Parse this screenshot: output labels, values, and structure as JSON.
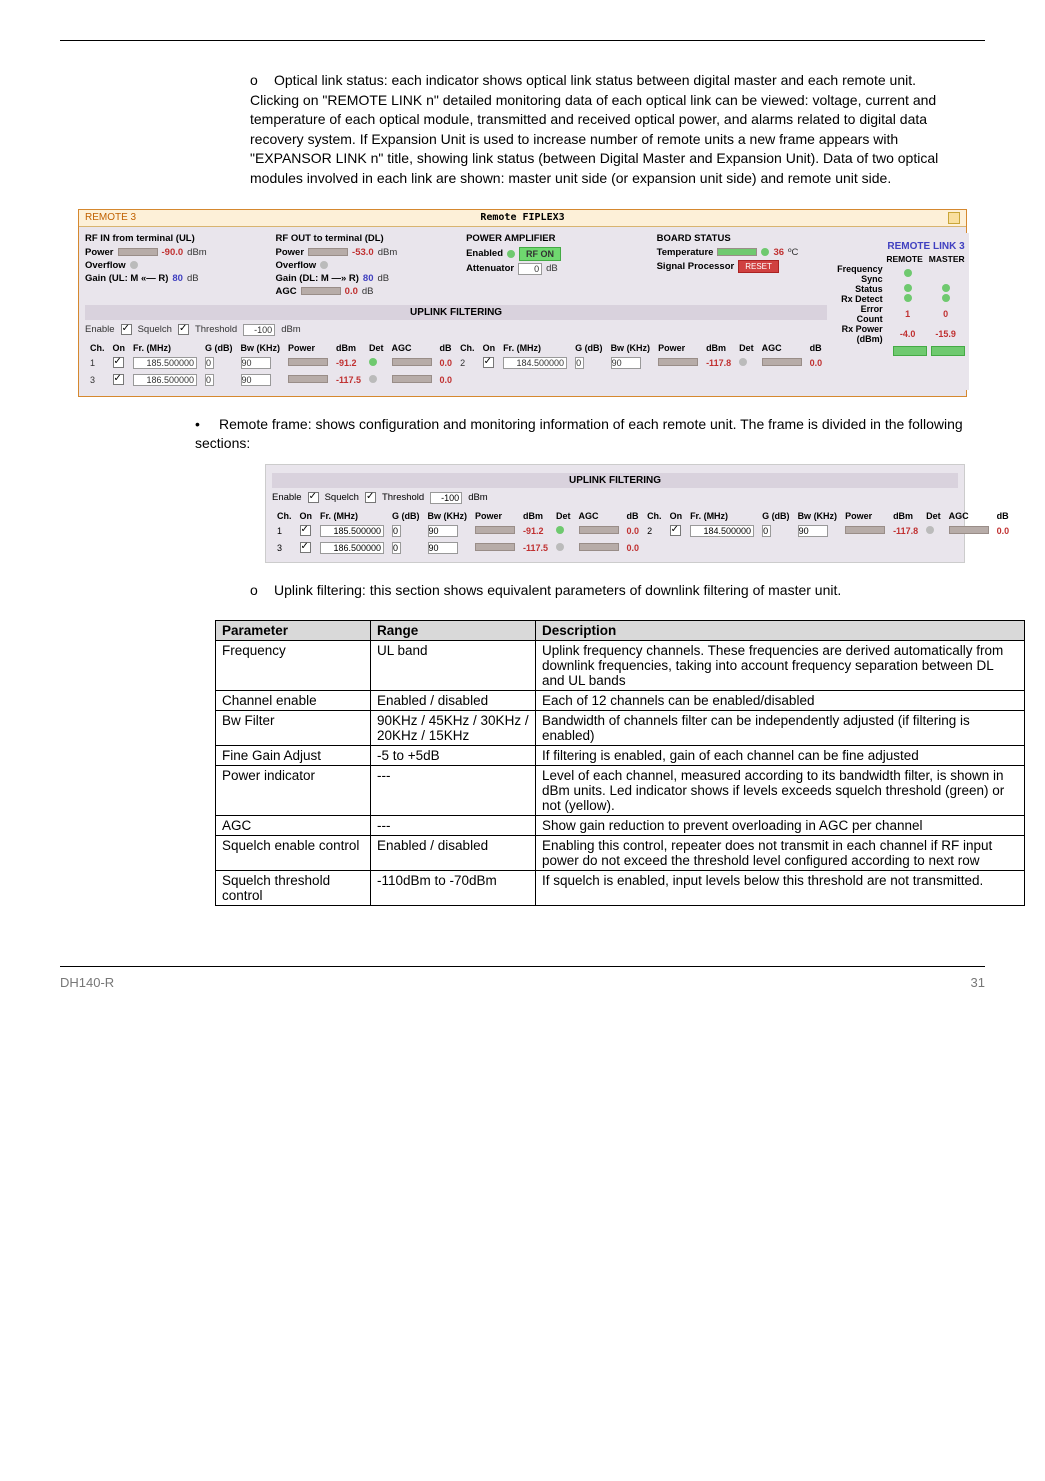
{
  "para1": "Optical link status: each indicator shows optical link status between digital master and each remote unit. Clicking on \"REMOTE LINK n\" detailed monitoring data of each optical link can be viewed: voltage, current and temperature of each optical module, transmitted and received optical power, and alarms related to digital data recovery system. If Expansion Unit is used to increase number of remote units a new frame appears with \"EXPANSOR LINK n\" title, showing link status (between Digital Master and Expansion Unit). Data of two optical modules involved in each link are shown: master unit side (or expansion unit side) and remote unit side.",
  "para2": "Remote frame: shows configuration and monitoring information of each remote unit. The frame is divided in the following sections:",
  "para3": "Uplink filtering: this section shows equivalent parameters of downlink filtering of master unit.",
  "panel": {
    "left_label": "REMOTE 3",
    "center_label": "Remote FIPLEX3",
    "rfin_title": "RF IN from terminal (UL)",
    "rfout_title": "RF OUT to terminal (DL)",
    "pa_title": "POWER AMPLIFIER",
    "board_title": "BOARD STATUS",
    "power": "Power",
    "overflow": "Overflow",
    "gain_ul": "Gain (UL: M «— R)",
    "gain_dl": "Gain (DL: M —» R)",
    "agc": "AGC",
    "enabled": "Enabled",
    "attenuator": "Attenuator",
    "temperature": "Temperature",
    "sigproc": "Signal Processor",
    "rf_on": "RF ON",
    "reset": "RESET",
    "val_rfin_power": "-90.0",
    "val_rfout_power": "-53.0",
    "val_gain_ul": "80",
    "val_gain_dl": "80",
    "val_agc": "0.0",
    "val_att": "0",
    "val_temp": "36",
    "unit_dbm": "dBm",
    "unit_db": "dB",
    "unit_c": "ºC",
    "uplink_banner": "UPLINK FILTERING",
    "enable_lbl": "Enable",
    "squelch_lbl": "Squelch",
    "threshold_lbl": "Threshold",
    "threshold_val": "-100",
    "hdr": {
      "ch": "Ch.",
      "on": "On",
      "fr": "Fr. (MHz)",
      "g": "G (dB)",
      "bw": "Bw (KHz)",
      "pwr": "Power",
      "dbm": "dBm",
      "det": "Det",
      "agc": "AGC",
      "db": "dB"
    },
    "rows": [
      {
        "ch": "1",
        "fr": "185.500000",
        "g": "0",
        "bw": "90",
        "pwr": "-91.2",
        "agc": "0.0"
      },
      {
        "ch": "2",
        "fr": "184.500000",
        "g": "0",
        "bw": "90",
        "pwr": "-117.8",
        "agc": "0.0"
      },
      {
        "ch": "3",
        "fr": "186.500000",
        "g": "0",
        "bw": "90",
        "pwr": "-117.5",
        "agc": "0.0"
      }
    ],
    "link_title": "REMOTE LINK 3",
    "link_hdr_remote": "REMOTE",
    "link_hdr_master": "MASTER",
    "link_rows": {
      "fs": "Frequency Sync",
      "status": "Status",
      "rxdet": "Rx Detect",
      "err": "Error Count",
      "rxpwr": "Rx Power (dBm)"
    },
    "link_vals": {
      "err_r": "1",
      "err_m": "0",
      "rx_r": "-4.0",
      "rx_m": "-15.9"
    }
  },
  "table": {
    "h1": "Parameter",
    "h2": "Range",
    "h3": "Description",
    "rows": [
      {
        "p": "Frequency",
        "r": "UL band",
        "d": "Uplink frequency channels. These frequencies are derived automatically from downlink frequencies, taking into account frequency separation between DL and UL bands"
      },
      {
        "p": "Channel enable",
        "r": "Enabled / disabled",
        "d": "Each of 12 channels can be enabled/disabled"
      },
      {
        "p": "Bw Filter",
        "r": "90KHz / 45KHz / 30KHz / 20KHz / 15KHz",
        "d": "Bandwidth of channels filter can be independently adjusted (if filtering is enabled)"
      },
      {
        "p": "Fine Gain Adjust",
        "r": "-5 to +5dB",
        "d": "If filtering is enabled, gain of each channel can be fine adjusted"
      },
      {
        "p": "Power indicator",
        "r": "---",
        "d": "Level of each channel, measured according to its bandwidth filter, is shown in dBm units. Led indicator shows if levels exceeds squelch threshold (green) or not (yellow)."
      },
      {
        "p": "AGC",
        "r": "---",
        "d": "Show gain reduction to prevent overloading in AGC per channel"
      },
      {
        "p": "Squelch enable control",
        "r": "Enabled / disabled",
        "d": "Enabling this control, repeater does not transmit in each channel if RF input power do not exceed the threshold level configured according to next row"
      },
      {
        "p": "Squelch threshold control",
        "r": "-110dBm to -70dBm",
        "d": "If squelch is enabled, input levels below this threshold are not transmitted."
      }
    ]
  },
  "footer": {
    "doc": "DH140-R",
    "page": "31"
  }
}
